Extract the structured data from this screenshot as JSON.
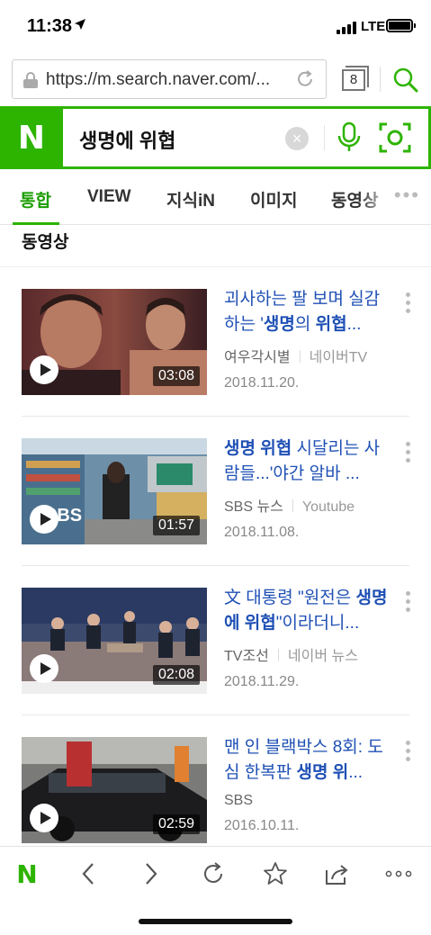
{
  "status_bar": {
    "time": "11:38",
    "network": "LTE"
  },
  "url_bar": {
    "url": "https://m.search.naver.com/...",
    "tab_count": "8"
  },
  "search_bar": {
    "logo": "N",
    "query": "생명에 위협"
  },
  "tabs": [
    {
      "label": "통합",
      "active": true
    },
    {
      "label": "VIEW"
    },
    {
      "label": "지식iN"
    },
    {
      "label": "이미지"
    },
    {
      "label": "동영상"
    }
  ],
  "section_title": "동영상",
  "videos": [
    {
      "title_a": "괴사하는 팔 보며 실감하는 '",
      "title_b": "생명",
      "title_c": "의 ",
      "title_d": "위협",
      "title_e": "...",
      "channel": "여우각시별",
      "source": "네이버TV",
      "date": "2018.11.20.",
      "duration": "03:08"
    },
    {
      "title_a": "",
      "title_b": "생명 위협",
      "title_c": " 시달리는 사람들...'야간 알바 ...",
      "title_d": "",
      "title_e": "",
      "channel": "SBS 뉴스",
      "source": "Youtube",
      "date": "2018.11.08.",
      "duration": "01:57"
    },
    {
      "title_a": "文 대통령 \"원전은 ",
      "title_b": "생명에 위협",
      "title_c": "\"이라더니...",
      "title_d": "",
      "title_e": "",
      "channel": "TV조선",
      "source": "네이버 뉴스",
      "date": "2018.11.29.",
      "duration": "02:08"
    },
    {
      "title_a": "맨 인 블랙박스 8회: 도심 한복판 ",
      "title_b": "생명 위",
      "title_c": "...",
      "title_d": "",
      "title_e": "",
      "channel": "SBS",
      "source": "",
      "date": "2016.10.11.",
      "duration": "02:59"
    }
  ],
  "toolbar": {
    "logo": "N"
  },
  "colors": {
    "naver_green": "#2db400",
    "link_blue": "#1f50b5"
  }
}
